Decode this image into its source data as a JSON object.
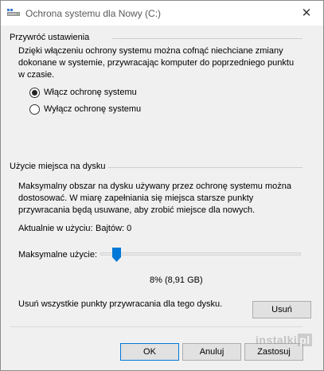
{
  "window": {
    "title": "Ochrona systemu dla Nowy (C:)",
    "close_glyph": "✕",
    "title_icon": "drive-icon"
  },
  "restore_settings": {
    "group_label": "Przywróć ustawienia",
    "description": "Dzięki włączeniu ochrony systemu można cofnąć niechciane zmiany dokonane w systemie, przywracając komputer do poprzedniego punktu w czasie.",
    "options": [
      {
        "label": "Włącz ochronę systemu",
        "checked": true
      },
      {
        "label": "Wyłącz ochronę systemu",
        "checked": false
      }
    ]
  },
  "disk_usage": {
    "group_label": "Użycie miejsca na dysku",
    "description": "Maksymalny obszar na dysku używany przez ochronę systemu można dostosować. W miarę zapełniania się miejsca starsze punkty przywracania będą usuwane, aby zrobić miejsce dla nowych.",
    "current_usage_label": "Aktualnie w użyciu:",
    "current_usage_value": "Bajtów: 0",
    "max_usage_label": "Maksymalne użycie:",
    "slider_value_percent": 8,
    "slider_readout": "8% (8,91 GB)",
    "delete_text": "Usuń wszystkie punkty przywracania dla tego dysku.",
    "delete_button": "Usuń"
  },
  "footer": {
    "ok": "OK",
    "cancel": "Anuluj",
    "apply": "Zastosuj"
  },
  "watermark": {
    "text": "instalki",
    "suffix": "pl"
  }
}
